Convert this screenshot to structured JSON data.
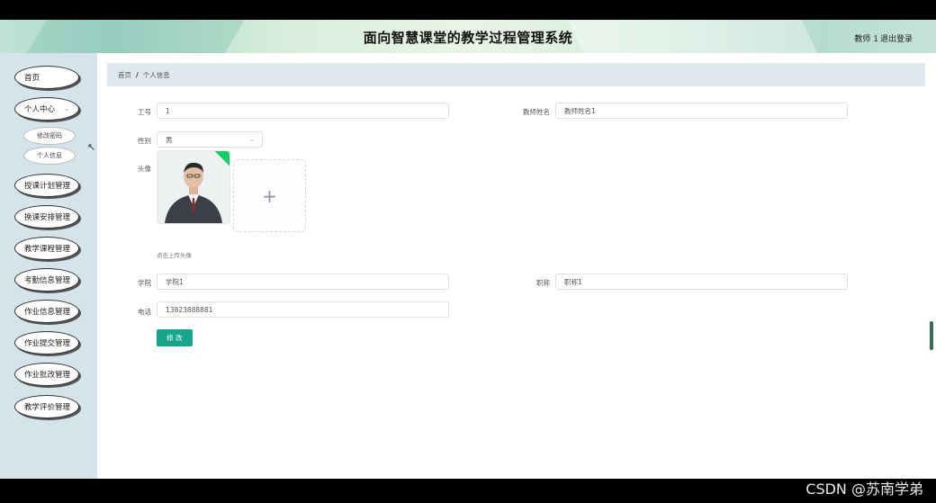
{
  "header": {
    "title": "面向智慧课堂的教学过程管理系统",
    "user": "教师 1",
    "logout": "退出登录"
  },
  "sidebar": {
    "items": [
      {
        "label": "首页"
      },
      {
        "label": "个人中心"
      },
      {
        "label": "修改密码"
      },
      {
        "label": "个人信息"
      },
      {
        "label": "授课计划管理"
      },
      {
        "label": "换课安排管理"
      },
      {
        "label": "教学课程管理"
      },
      {
        "label": "考勤信息管理"
      },
      {
        "label": "作业信息管理"
      },
      {
        "label": "作业提交管理"
      },
      {
        "label": "作业批改管理"
      },
      {
        "label": "教学评价管理"
      }
    ]
  },
  "breadcrumb": {
    "home": "首页",
    "separator": "/",
    "current": "个人信息"
  },
  "form": {
    "id_label": "工号",
    "id_value": "1",
    "name_label": "教师姓名",
    "name_value": "教师姓名1",
    "gender_label": "性别",
    "gender_value": "男",
    "avatar_label": "头像",
    "upload_plus": "+",
    "upload_hint": "点击上传头像",
    "college_label": "学院",
    "college_value": "学院1",
    "title_label": "职称",
    "title_value": "职称1",
    "phone_label": "电话",
    "phone_value": "13823888881",
    "submit_label": "修 改"
  },
  "watermark": "CSDN @苏南学弟",
  "colors": {
    "accent": "#17a589",
    "sidebar_bg": "#d5e4ea",
    "breadcrumb_bg": "#dfe9ee"
  }
}
